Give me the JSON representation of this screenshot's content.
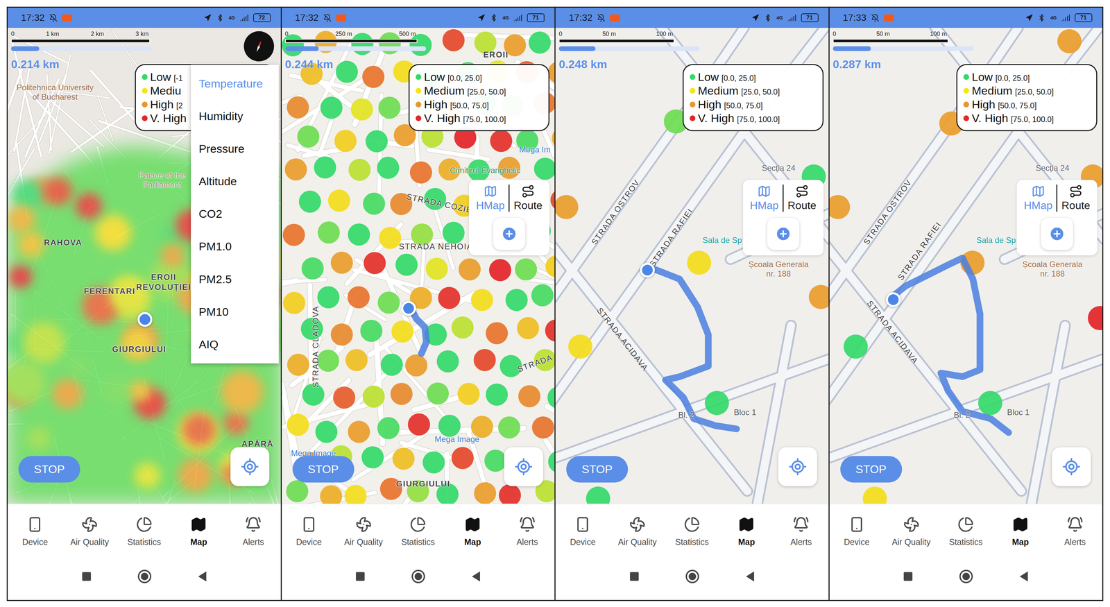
{
  "phones": [
    {
      "status": {
        "time": "17:32",
        "network": "4G",
        "battery": "72"
      },
      "scale": [
        "0",
        "1 km",
        "2 km",
        "3 km"
      ],
      "progress": 0.2,
      "distance": "0.214 km",
      "legend": [
        {
          "label": "Low",
          "range": "[-1",
          "color": "#35d96b"
        },
        {
          "label": "Mediu",
          "range": "",
          "color": "#f5e51b"
        },
        {
          "label": "High",
          "range": "[2",
          "color": "#e9962f"
        },
        {
          "label": "V. High",
          "range": "",
          "color": "#e3262a"
        }
      ],
      "compass": true,
      "menu": [
        {
          "label": "Temperature",
          "selected": true
        },
        {
          "label": "Humidity",
          "selected": false
        },
        {
          "label": "Pressure",
          "selected": false
        },
        {
          "label": "Altitude",
          "selected": false
        },
        {
          "label": "CO2",
          "selected": false
        },
        {
          "label": "PM1.0",
          "selected": false
        },
        {
          "label": "PM2.5",
          "selected": false
        },
        {
          "label": "PM10",
          "selected": false
        },
        {
          "label": "AIQ",
          "selected": false
        }
      ],
      "layer": {
        "kind": "heatmap",
        "values": [
          15,
          30,
          45,
          60,
          75,
          85,
          25,
          50,
          35,
          70,
          20,
          40,
          65,
          80,
          10,
          55,
          30,
          45,
          70,
          90,
          35,
          60,
          25,
          50,
          75,
          40,
          20,
          65,
          85,
          30,
          55,
          45,
          15,
          70,
          60,
          35,
          80,
          25,
          50,
          40,
          65,
          30,
          75,
          20,
          55,
          45,
          85,
          35,
          60,
          25
        ]
      },
      "labels": [
        {
          "text": "Politehnica University",
          "kind": "poi",
          "color": "#9b6a45"
        },
        {
          "text": "of Bucharest",
          "kind": "poi",
          "color": "#9b6a45"
        },
        {
          "text": "Palace of the",
          "kind": "poi",
          "color": "#a88670"
        },
        {
          "text": "Parliament",
          "kind": "poi",
          "color": "#a88670"
        },
        {
          "text": "RAHOVA",
          "kind": "district",
          "color": "#454545"
        },
        {
          "text": "FERENTARI",
          "kind": "district",
          "color": "#454545"
        },
        {
          "text": "EROII",
          "kind": "district",
          "color": "#454545"
        },
        {
          "text": "REVOLUȚIEI",
          "kind": "district",
          "color": "#454545"
        },
        {
          "text": "GIURGIULUI",
          "kind": "district",
          "color": "#454545"
        },
        {
          "text": "APĂRĂ",
          "kind": "district",
          "color": "#454545"
        }
      ],
      "actions": [],
      "stop": "STOP"
    },
    {
      "status": {
        "time": "17:32",
        "network": "4G",
        "battery": "71"
      },
      "scale": [
        "0",
        "250 m",
        "500 m"
      ],
      "progress": 0.24,
      "distance": "0.244 km",
      "legend": [
        {
          "label": "Low",
          "range": "[0.0, 25.0]",
          "color": "#35d96b"
        },
        {
          "label": "Medium",
          "range": "[25.0, 50.0]",
          "color": "#f5e51b"
        },
        {
          "label": "High",
          "range": "[50.0, 75.0]",
          "color": "#e9962f"
        },
        {
          "label": "V. High",
          "range": "[75.0, 100.0]",
          "color": "#e3262a"
        }
      ],
      "compass": false,
      "menu": [],
      "layer": {
        "kind": "dots",
        "values": [
          10,
          55,
          8,
          20,
          5,
          80,
          30,
          60,
          5,
          50,
          12,
          70,
          40,
          15,
          10,
          35,
          75,
          60,
          65,
          5,
          35,
          20,
          10,
          45,
          8,
          20,
          70,
          20,
          45,
          5,
          60,
          30,
          90,
          85,
          15,
          55,
          60,
          10,
          30,
          8,
          70,
          55,
          5,
          60,
          10,
          5,
          40,
          15,
          65,
          10,
          45,
          30,
          5,
          80,
          70,
          20,
          8,
          40,
          25,
          5,
          50,
          75,
          10,
          15,
          60,
          85,
          5,
          35,
          60,
          90,
          20,
          45,
          45,
          10,
          70,
          20,
          55,
          85,
          40,
          8,
          15,
          8,
          65,
          15,
          40,
          10,
          30,
          70,
          50,
          85,
          55,
          20,
          50,
          8,
          60,
          12,
          80,
          10,
          30,
          10,
          75,
          30,
          65,
          20,
          45,
          5,
          65,
          8,
          40,
          5,
          60,
          15,
          85,
          10,
          55,
          20,
          70,
          65,
          30,
          10,
          50,
          5,
          80,
          15,
          40,
          12,
          20,
          55,
          40,
          70,
          25,
          10,
          60,
          85,
          30
        ]
      },
      "labels": [
        {
          "text": "EROII",
          "kind": "district",
          "color": "#454545"
        },
        {
          "text": "Cimitirul Evanghelic",
          "kind": "poi",
          "color": "#3f8f5c"
        },
        {
          "text": "STRADA COZIE",
          "kind": "street",
          "color": "#3a3a3a"
        },
        {
          "text": "STRADA NEHOIA",
          "kind": "street",
          "color": "#3a3a3a"
        },
        {
          "text": "STRADA CLADOVA",
          "kind": "street",
          "color": "#3a3a3a"
        },
        {
          "text": "Mega Image",
          "kind": "poi",
          "color": "#3f7fd0"
        },
        {
          "text": "Mega Image",
          "kind": "poi",
          "color": "#3f7fd0"
        },
        {
          "text": "Mega Im",
          "kind": "poi",
          "color": "#3f7fd0"
        },
        {
          "text": "GIURGIULUI",
          "kind": "district",
          "color": "#454545"
        },
        {
          "text": "STRADA",
          "kind": "street",
          "color": "#3a3a3a"
        }
      ],
      "actions": [
        {
          "label": "HMap",
          "selected": true
        },
        {
          "label": "Route",
          "selected": false
        }
      ],
      "stop": "STOP"
    },
    {
      "status": {
        "time": "17:32",
        "network": "4G",
        "battery": "71"
      },
      "scale": [
        "0",
        "50 m",
        "100 m"
      ],
      "progress": 0.26,
      "distance": "0.248 km",
      "legend": [
        {
          "label": "Low",
          "range": "[0.0, 25.0]",
          "color": "#35d96b"
        },
        {
          "label": "Medium",
          "range": "[25.0, 50.0]",
          "color": "#f5e51b"
        },
        {
          "label": "High",
          "range": "[50.0, 75.0]",
          "color": "#e9962f"
        },
        {
          "label": "V. High",
          "range": "[75.0, 100.0]",
          "color": "#e3262a"
        }
      ],
      "compass": false,
      "menu": [],
      "layer": {
        "kind": "markers",
        "values": [
          60,
          20,
          5,
          40,
          40,
          5,
          60,
          5
        ]
      },
      "labels": [
        {
          "text": "STRADA OSTROV",
          "kind": "street",
          "color": "#3a3a3a"
        },
        {
          "text": "STRADA RAFIEI",
          "kind": "street",
          "color": "#3a3a3a"
        },
        {
          "text": "STRADA ACIDAVA",
          "kind": "street",
          "color": "#3a3a3a"
        },
        {
          "text": "Secția 24",
          "kind": "poi",
          "color": "#5f6670"
        },
        {
          "text": "Sala de Sp",
          "kind": "poi",
          "color": "#159e9e"
        },
        {
          "text": "Școala Generala",
          "kind": "poi",
          "color": "#9b6a45"
        },
        {
          "text": "nr. 188",
          "kind": "poi",
          "color": "#9b6a45"
        },
        {
          "text": "Bl. 2",
          "kind": "poi",
          "color": "#555555"
        },
        {
          "text": "Bloc 1",
          "kind": "poi",
          "color": "#555555"
        }
      ],
      "actions": [
        {
          "label": "HMap",
          "selected": true
        },
        {
          "label": "Route",
          "selected": false
        }
      ],
      "stop": "STOP"
    },
    {
      "status": {
        "time": "17:33",
        "network": "4G",
        "battery": "71"
      },
      "scale": [
        "0",
        "50 m",
        "100 m"
      ],
      "progress": 0.27,
      "distance": "0.287 km",
      "legend": [
        {
          "label": "Low",
          "range": "[0.0, 25.0]",
          "color": "#35d96b"
        },
        {
          "label": "Medium",
          "range": "[25.0, 50.0]",
          "color": "#f5e51b"
        },
        {
          "label": "High",
          "range": "[50.0, 75.0]",
          "color": "#e9962f"
        },
        {
          "label": "V. High",
          "range": "[75.0, 100.0]",
          "color": "#e3262a"
        }
      ],
      "compass": false,
      "menu": [],
      "layer": {
        "kind": "markers",
        "values": [
          60,
          60,
          60,
          60,
          5,
          5,
          90,
          60,
          40
        ]
      },
      "labels": [
        {
          "text": "STRADA OSTROV",
          "kind": "street",
          "color": "#3a3a3a"
        },
        {
          "text": "STRADA RAFIEI",
          "kind": "street",
          "color": "#3a3a3a"
        },
        {
          "text": "STRADA ACIDAVA",
          "kind": "street",
          "color": "#3a3a3a"
        },
        {
          "text": "Secția 24",
          "kind": "poi",
          "color": "#5f6670"
        },
        {
          "text": "Sala de Sp",
          "kind": "poi",
          "color": "#159e9e"
        },
        {
          "text": "Școala Generala",
          "kind": "poi",
          "color": "#9b6a45"
        },
        {
          "text": "nr. 188",
          "kind": "poi",
          "color": "#9b6a45"
        },
        {
          "text": "Bl. 2",
          "kind": "poi",
          "color": "#555555"
        },
        {
          "text": "Bloc 1",
          "kind": "poi",
          "color": "#555555"
        }
      ],
      "actions": [
        {
          "label": "HMap",
          "selected": true
        },
        {
          "label": "Route",
          "selected": false
        }
      ],
      "stop": "STOP"
    }
  ],
  "bottom_nav": [
    {
      "label": "Device",
      "selected": false
    },
    {
      "label": "Air Quality",
      "selected": false
    },
    {
      "label": "Statistics",
      "selected": false
    },
    {
      "label": "Map",
      "selected": true
    },
    {
      "label": "Alerts",
      "selected": false
    }
  ]
}
